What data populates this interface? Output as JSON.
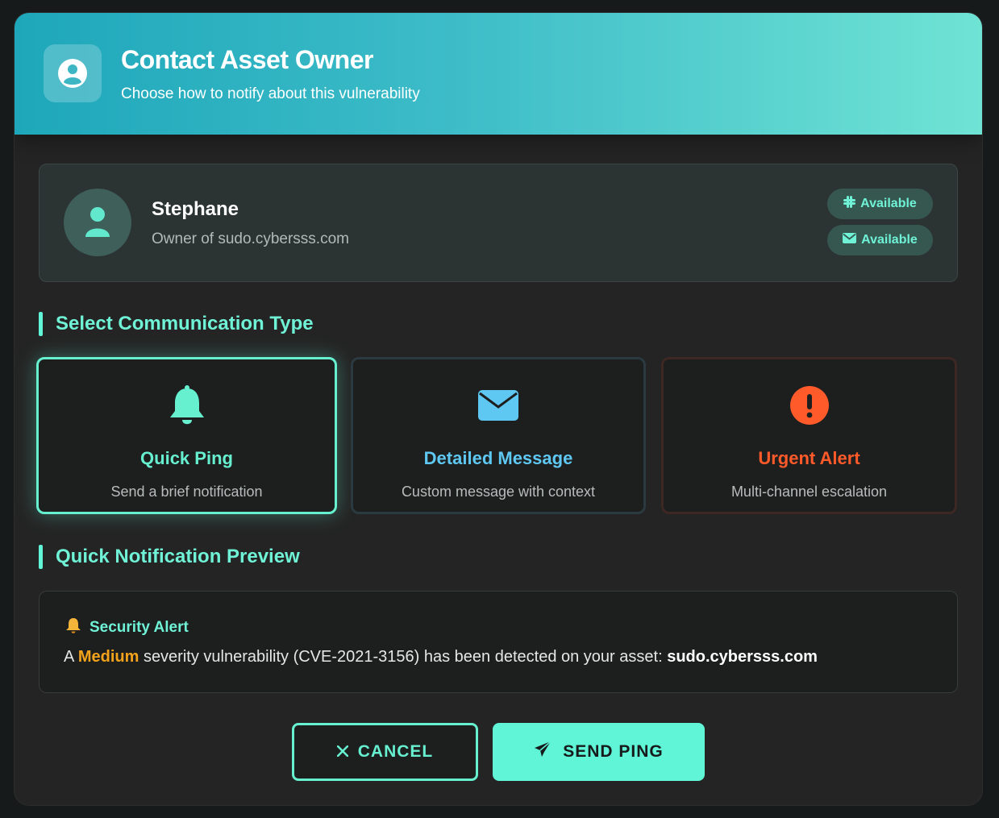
{
  "header": {
    "title": "Contact Asset Owner",
    "subtitle": "Choose how to notify about this vulnerability",
    "icon": "user-circle-icon"
  },
  "owner": {
    "name": "Stephane",
    "role": "Owner of sudo.cybersss.com",
    "badges": [
      {
        "icon": "slack-icon",
        "label": "Available"
      },
      {
        "icon": "envelope-icon",
        "label": "Available"
      }
    ]
  },
  "communication": {
    "section_title": "Select Communication Type",
    "options": [
      {
        "icon": "bell-icon",
        "title": "Quick Ping",
        "description": "Send a brief notification",
        "color": "#66f0d0",
        "selected": true
      },
      {
        "icon": "envelope-icon",
        "title": "Detailed Message",
        "description": "Custom message with context",
        "color": "#5ec8f2",
        "selected": false
      },
      {
        "icon": "exclamation-circle-icon",
        "title": "Urgent Alert",
        "description": "Multi-channel escalation",
        "color": "#ff5a2a",
        "selected": false
      }
    ]
  },
  "preview": {
    "section_title": "Quick Notification Preview",
    "heading": "Security Alert",
    "text_prefix": "A",
    "severity": "Medium",
    "text_middle": "severity vulnerability (CVE-2021-3156) has been detected on your asset:",
    "asset": "sudo.cybersss.com"
  },
  "actions": {
    "cancel_label": "CANCEL",
    "send_label": "SEND PING"
  },
  "colors": {
    "accent": "#5ff5d6",
    "severity_medium": "#f2a31b",
    "urgent": "#ff5a2a",
    "info": "#5ec8f2"
  }
}
